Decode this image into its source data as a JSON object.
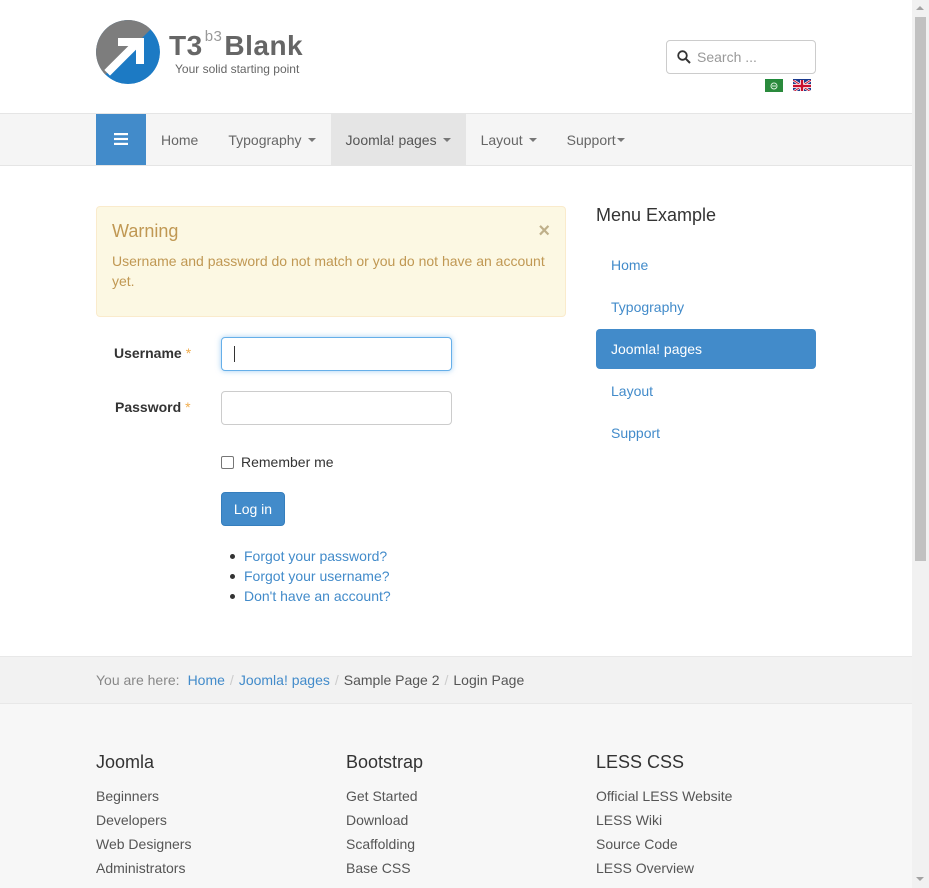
{
  "header": {
    "logo_main": "T3",
    "logo_sup": "b3",
    "logo_word": "Blank",
    "tagline": "Your solid starting point",
    "search_placeholder": "Search ..."
  },
  "navbar": {
    "items": [
      {
        "label": "Home",
        "dropdown": false
      },
      {
        "label": "Typography",
        "dropdown": true
      },
      {
        "label": "Joomla! pages",
        "dropdown": true
      },
      {
        "label": "Layout",
        "dropdown": true
      },
      {
        "label": "Support",
        "dropdown": true
      }
    ],
    "active": "Joomla! pages"
  },
  "alert": {
    "title": "Warning",
    "close": "×",
    "message": "Username and password do not match or you do not have an account yet."
  },
  "login": {
    "username_label": "Username",
    "password_label": "Password",
    "required_mark": "*",
    "remember_label": "Remember me",
    "remember_checked": false,
    "button_label": "Log in",
    "links": [
      "Forgot your password?",
      "Forgot your username?",
      "Don't have an account?"
    ]
  },
  "sidebar": {
    "title": "Menu Example",
    "items": [
      "Home",
      "Typography",
      "Joomla! pages",
      "Layout",
      "Support"
    ],
    "active": "Joomla! pages"
  },
  "breadcrumb": {
    "prefix": "You are here:",
    "items": [
      {
        "label": "Home",
        "link": true
      },
      {
        "label": "Joomla! pages",
        "link": true
      },
      {
        "label": "Sample Page 2",
        "link": false
      },
      {
        "label": "Login Page",
        "link": false
      }
    ],
    "separator": "/"
  },
  "footer": {
    "columns": [
      {
        "title": "Joomla",
        "links": [
          "Beginners",
          "Developers",
          "Web Designers",
          "Administrators"
        ]
      },
      {
        "title": "Bootstrap",
        "links": [
          "Get Started",
          "Download",
          "Scaffolding",
          "Base CSS"
        ]
      },
      {
        "title": "LESS CSS",
        "links": [
          "Official LESS Website",
          "LESS Wiki",
          "Source Code",
          "LESS Overview"
        ]
      }
    ]
  },
  "colors": {
    "primary": "#428bca",
    "warning_bg": "#fcf8e3",
    "warning_text": "#c09853"
  },
  "icons": [
    "logo-arrow-icon",
    "search-icon",
    "hamburger-icon",
    "close-icon",
    "flag-arabic-icon",
    "flag-uk-icon"
  ]
}
